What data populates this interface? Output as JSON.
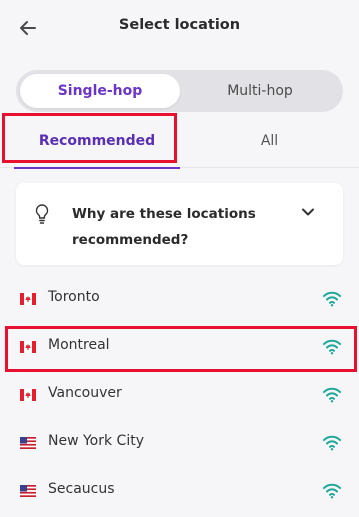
{
  "header": {
    "title": "Select location"
  },
  "hop_toggle": {
    "options": [
      "Single-hop",
      "Multi-hop"
    ],
    "selected": "Single-hop"
  },
  "tabs": {
    "items": [
      "Recommended",
      "All"
    ],
    "selected": "Recommended"
  },
  "info_card": {
    "text": "Why are these locations recommended?"
  },
  "locations": [
    {
      "city": "Toronto",
      "flag": "canada-flag-icon",
      "signal": "wifi-signal-icon"
    },
    {
      "city": "Montreal",
      "flag": "canada-flag-icon",
      "signal": "wifi-signal-icon"
    },
    {
      "city": "Vancouver",
      "flag": "canada-flag-icon",
      "signal": "wifi-signal-icon"
    },
    {
      "city": "New York City",
      "flag": "usa-flag-icon",
      "signal": "wifi-signal-icon"
    },
    {
      "city": "Secaucus",
      "flag": "usa-flag-icon",
      "signal": "wifi-signal-icon"
    }
  ],
  "colors": {
    "accent": "#6b35c9",
    "signal": "#1aa89a",
    "highlight": "#e8102f",
    "background": "#f6f6f8"
  }
}
